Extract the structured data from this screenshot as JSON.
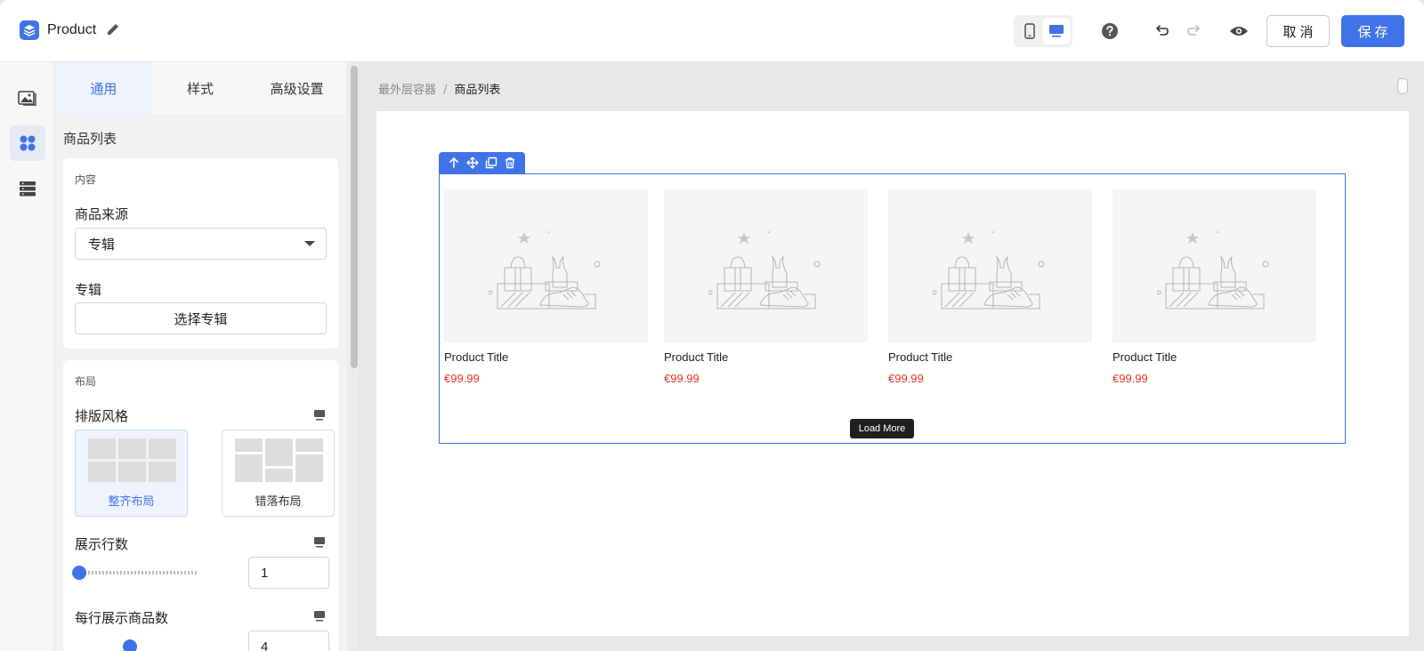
{
  "header": {
    "app_title": "Product",
    "icons": {
      "logo": "layers-icon",
      "edit": "pencil-icon",
      "mobile": "mobile-icon",
      "desktop": "desktop-icon",
      "help": "help-circle-icon",
      "undo": "undo-icon",
      "redo": "redo-icon",
      "preview": "eye-icon"
    },
    "cancel_label": "取消",
    "save_label": "保存",
    "accent_color": "#3f74e8"
  },
  "rail": {
    "items": [
      {
        "icon": "image-icon",
        "active": false
      },
      {
        "icon": "components-icon",
        "active": true
      },
      {
        "icon": "list-icon",
        "active": false
      }
    ]
  },
  "panel": {
    "tabs": [
      {
        "label": "通用",
        "active": true
      },
      {
        "label": "样式",
        "active": false
      },
      {
        "label": "高级设置",
        "active": false
      }
    ],
    "section_title": "商品列表",
    "content_card": {
      "title": "内容",
      "source_label": "商品来源",
      "source_value": "专辑",
      "album_label": "专辑",
      "album_button": "选择专辑"
    },
    "layout_card": {
      "title": "布局",
      "style_label": "排版风格",
      "options": [
        {
          "label": "整齐布局",
          "selected": true
        },
        {
          "label": "错落布局",
          "selected": false
        }
      ],
      "rows_label": "展示行数",
      "rows_value": "1",
      "rows_slider_fraction": 0,
      "per_row_label": "每行展示商品数",
      "per_row_value": "4"
    }
  },
  "canvas": {
    "breadcrumb": [
      "最外层容器",
      "商品列表"
    ],
    "products": [
      {
        "title": "Product Title",
        "price": "€99.99"
      },
      {
        "title": "Product Title",
        "price": "€99.99"
      },
      {
        "title": "Product Title",
        "price": "€99.99"
      },
      {
        "title": "Product Title",
        "price": "€99.99"
      }
    ],
    "load_more_label": "Load More",
    "block_toolbar_icons": [
      "arrow-up-icon",
      "move-icon",
      "copy-icon",
      "trash-icon"
    ],
    "price_color": "#e4322b"
  }
}
